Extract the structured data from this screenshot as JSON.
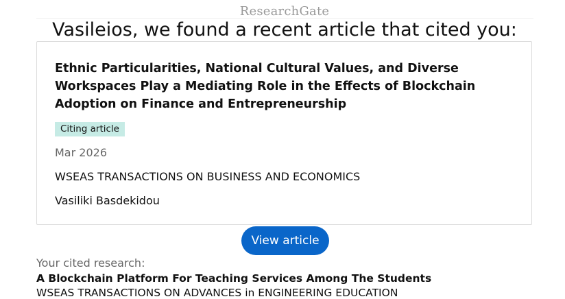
{
  "brand": {
    "logo_text": "ResearchGate"
  },
  "headline": "Vasileios, we found a recent article that cited you:",
  "citing_article": {
    "title": "Ethnic Particularities, National Cultural Values, and Diverse Workspaces Play a Mediating Role in the Effects of Blockchain Adoption on Finance and Entrepreneurship",
    "badge": "Citing article",
    "date": "Mar 2026",
    "journal": "WSEAS TRANSACTIONS ON BUSINESS AND ECONOMICS",
    "author": "Vasiliki Basdekidou"
  },
  "actions": {
    "view_article_label": "View article"
  },
  "cited_research": {
    "label": "Your cited research:",
    "title": "A Blockchain Platform For Teaching Services Among The Students",
    "journal": "WSEAS TRANSACTIONS ON ADVANCES in ENGINEERING EDUCATION"
  },
  "colors": {
    "button_bg": "#0a66c9",
    "badge_bg": "#c6ebe5",
    "muted_text": "#666666",
    "logo_text": "#9a9a9a"
  }
}
